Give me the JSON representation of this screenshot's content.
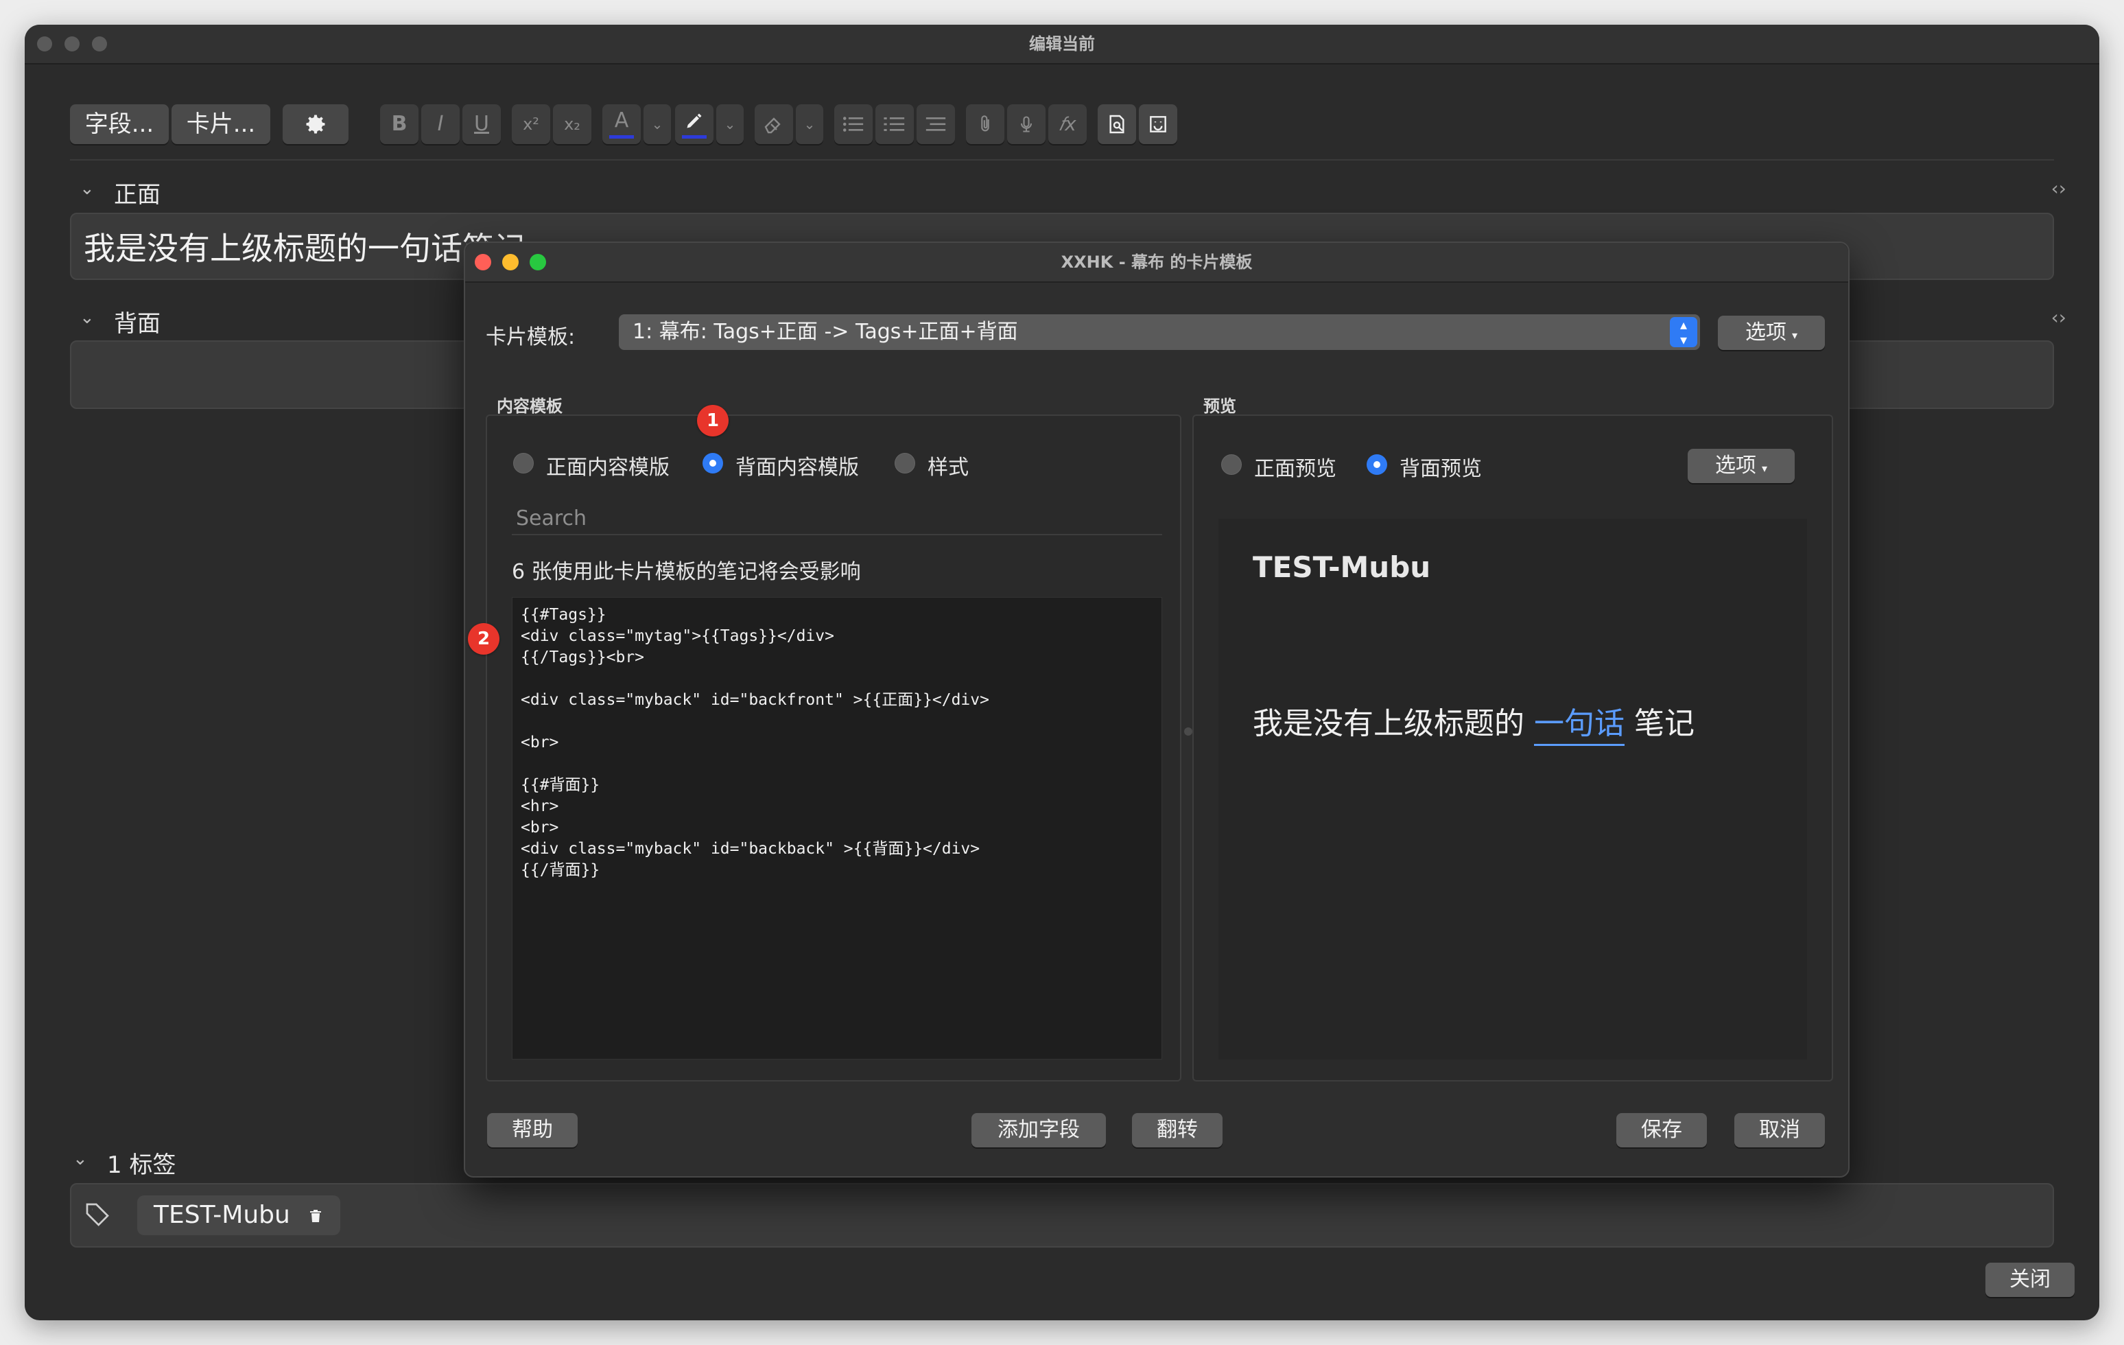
{
  "window": {
    "title": "编辑当前"
  },
  "toolbar": {
    "fields_label": "字段...",
    "cards_label": "卡片...",
    "icons": [
      "gear-icon",
      "bold-icon",
      "italic-icon",
      "underline-icon",
      "superscript-icon",
      "subscript-icon",
      "text-color-icon",
      "highlight-icon",
      "eraser-icon",
      "bullet-list-icon",
      "numbered-list-icon",
      "align-icon",
      "attach-icon",
      "mic-icon",
      "function-icon",
      "find-icon",
      "smile-icon"
    ],
    "glyphs": {
      "bold": "B",
      "italic": "I",
      "underline": "U",
      "superscript": "x²",
      "subscript": "x₂",
      "text_color": "A",
      "function": "𝑓x"
    },
    "text_color_hex": "#2d3bd9",
    "highlight_hex": "#2d3bd9"
  },
  "fields": [
    {
      "label": "正面",
      "value": "我是没有上级标题的一句话笔记"
    },
    {
      "label": "背面",
      "value": ""
    }
  ],
  "tags": {
    "label": "1 标签",
    "items": [
      "TEST-Mubu"
    ]
  },
  "close_button": "关闭",
  "dialog": {
    "title": "XXHK - 幕布 的卡片模板",
    "card_template_label": "卡片模板:",
    "card_template_value": "1: 幕布: Tags+正面 -> Tags+正面+背面",
    "options_button": "选项",
    "content_section_label": "内容模板",
    "preview_section_label": "预览",
    "content_radios": [
      {
        "label": "正面内容模版",
        "selected": false
      },
      {
        "label": "背面内容模版",
        "selected": true
      },
      {
        "label": "样式",
        "selected": false
      }
    ],
    "search_placeholder": "Search",
    "affected_notice": "6 张使用此卡片模板的笔记将会受影响",
    "code_lines": [
      "{{#Tags}}",
      "<div class=\"mytag\">{{Tags}}</div>",
      "{{/Tags}}<br>",
      "",
      "<div class=\"myback\" id=\"backfront\" >{{正面}}</div>",
      "",
      "<br>",
      "",
      "{{#背面}}",
      "<hr>",
      "<br>",
      "<div class=\"myback\" id=\"backback\" >{{背面}}</div>",
      "{{/背面}}"
    ],
    "preview_radios": [
      {
        "label": "正面预览",
        "selected": false
      },
      {
        "label": "背面预览",
        "selected": true
      }
    ],
    "preview_options_button": "选项",
    "preview": {
      "tag": "TEST-Mubu",
      "text_before": "我是没有上级标题的 ",
      "text_highlight": "一句话",
      "text_after": " 笔记",
      "highlight_color": "#5b9cff"
    },
    "buttons": {
      "help": "帮助",
      "add_field": "添加字段",
      "flip": "翻转",
      "save": "保存",
      "cancel": "取消"
    },
    "badges": [
      "1",
      "2"
    ]
  }
}
